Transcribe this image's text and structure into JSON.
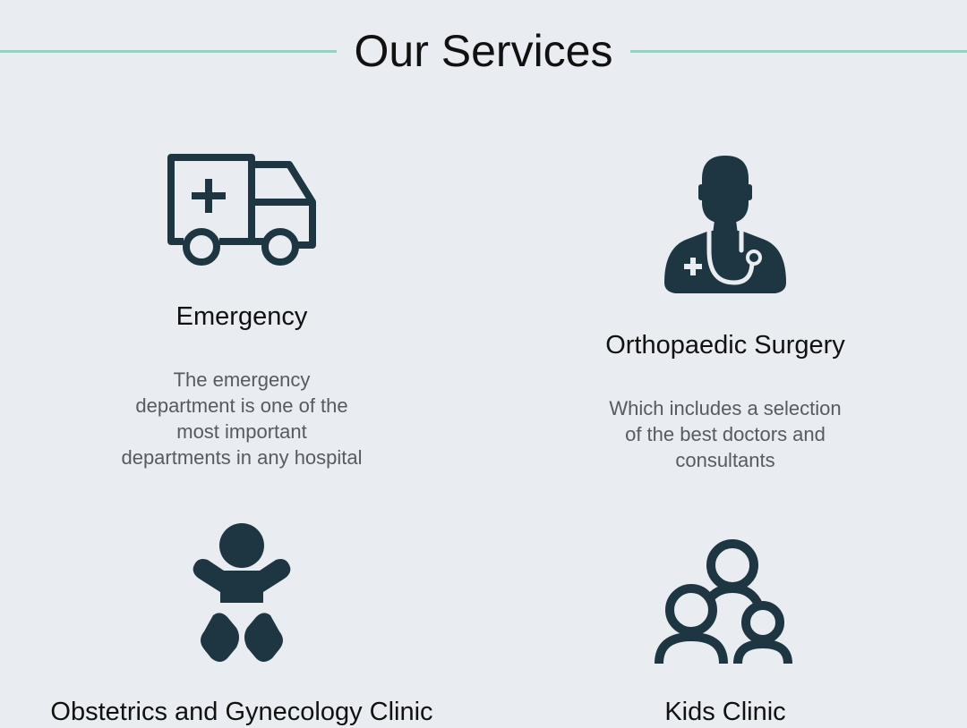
{
  "section": {
    "title": "Our Services"
  },
  "colors": {
    "background": "#e9edf1",
    "icon": "#1e3641",
    "accent_rule": "#9bcfc3",
    "title_text": "#111111",
    "body_text": "#555b60"
  },
  "services": [
    {
      "icon": "ambulance-icon",
      "title": "Emergency",
      "description": "The emergency department is one of the most important departments in any hospital"
    },
    {
      "icon": "doctor-icon",
      "title": "Orthopaedic Surgery",
      "description": "Which includes a selection of the best doctors and consultants"
    },
    {
      "icon": "baby-icon",
      "title": "Obstetrics and Gynecology Clinic",
      "description": ""
    },
    {
      "icon": "family-icon",
      "title": "Kids Clinic",
      "description": ""
    }
  ]
}
